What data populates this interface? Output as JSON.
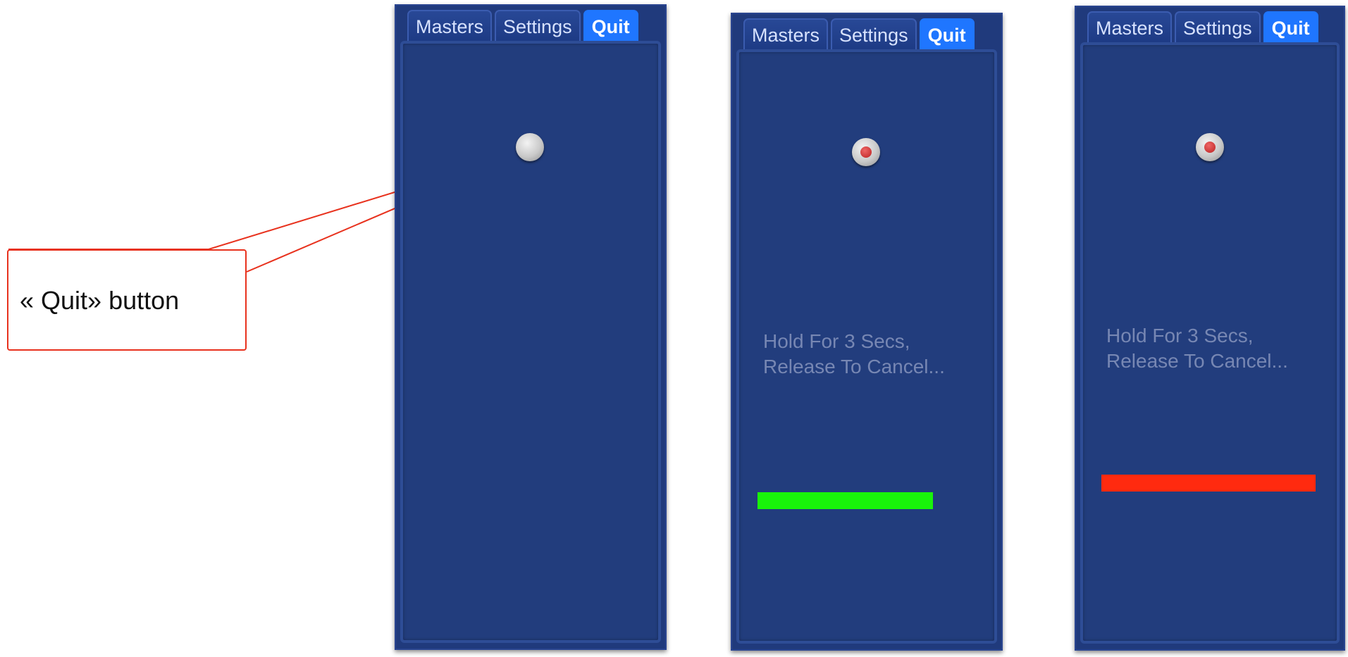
{
  "callout": {
    "label": "« Quit» button"
  },
  "panels": [
    {
      "tabs": [
        "Masters",
        "Settings",
        "Quit"
      ],
      "active_tab": "Quit",
      "quit_button_state": "idle"
    },
    {
      "tabs": [
        "Masters",
        "Settings",
        "Quit"
      ],
      "active_tab": "Quit",
      "quit_button_state": "pressed",
      "hold_text_line1": "Hold For 3 Secs,",
      "hold_text_line2": "Release To Cancel...",
      "progress_color": "#19f40a",
      "progress_fraction": 0.82
    },
    {
      "tabs": [
        "Masters",
        "Settings",
        "Quit"
      ],
      "active_tab": "Quit",
      "quit_button_state": "pressed",
      "hold_text_line1": "Hold For 3 Secs,",
      "hold_text_line2": "Release To Cancel...",
      "progress_color": "#ff2a0f",
      "progress_fraction": 1.0
    }
  ],
  "colors": {
    "panel_bg": "#223d7d",
    "active_tab": "#1f76ff",
    "callout_border": "#e8321e"
  }
}
